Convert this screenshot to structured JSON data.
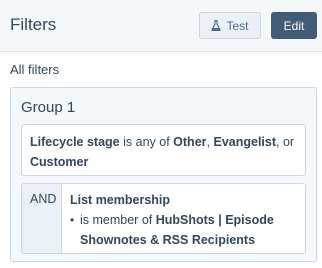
{
  "header": {
    "title": "Filters",
    "test_label": "Test",
    "edit_label": "Edit",
    "test_icon": "flask-icon"
  },
  "all_filters_label": "All filters",
  "group": {
    "title": "Group 1",
    "filter1": {
      "property": "Lifecycle stage",
      "connector": "is any of",
      "value1": "Other",
      "value2": "Evangelist",
      "sep": ",",
      "or_word": ", or",
      "value3": "Customer"
    },
    "filter2": {
      "operator": "AND",
      "property": "List membership",
      "bullet": "•",
      "condition": "is member of",
      "list_name": "HubShots | Episode Shownotes & RSS Recipients"
    }
  },
  "colors": {
    "header_bg": "#f5f8fa",
    "text": "#33475b",
    "edit_button_bg": "#425b76",
    "test_button_bg": "#eaf0f6",
    "border": "#cbd6e2"
  }
}
